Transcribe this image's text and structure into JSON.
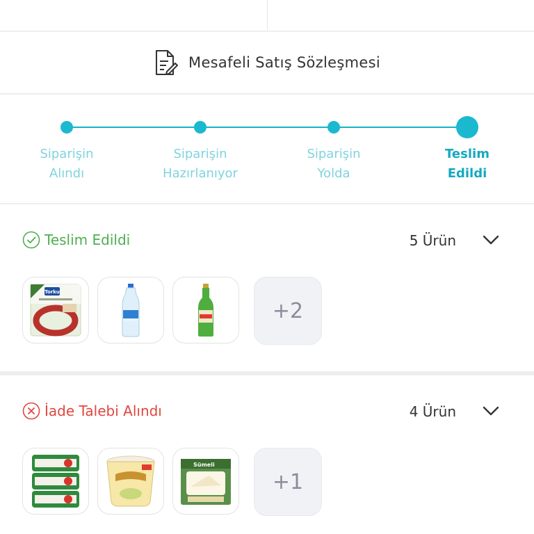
{
  "contract": {
    "label": "Mesafeli Satış Sözleşmesi",
    "icon": "document-pen-icon"
  },
  "tracker": {
    "accent": "#1ab9cf",
    "steps": [
      {
        "line1": "Siparişin",
        "line2": "Alındı"
      },
      {
        "line1": "Siparişin",
        "line2": "Hazırlanıyor"
      },
      {
        "line1": "Siparişin",
        "line2": "Yolda"
      },
      {
        "line1": "Teslim",
        "line2": "Edildi"
      }
    ],
    "current_step": 4
  },
  "orders": [
    {
      "status": "Teslim Edildi",
      "status_color": "#4caf50",
      "status_icon": "check-circle-icon",
      "count": "5 Ürün",
      "products": [
        {
          "name": "Torku",
          "icon": "sausage-pack-icon"
        },
        {
          "icon": "water-bottle-icon"
        },
        {
          "icon": "mineral-water-bottle-icon"
        }
      ],
      "more": "+2"
    },
    {
      "status": "İade Talebi Alındı",
      "status_color": "#e0463e",
      "status_icon": "x-circle-icon",
      "count": "4 Ürün",
      "products": [
        {
          "icon": "cheese-tubs-icon"
        },
        {
          "icon": "yogurt-tub-icon"
        },
        {
          "name": "Sümeli",
          "icon": "cheese-box-icon"
        }
      ],
      "more": "+1"
    }
  ]
}
